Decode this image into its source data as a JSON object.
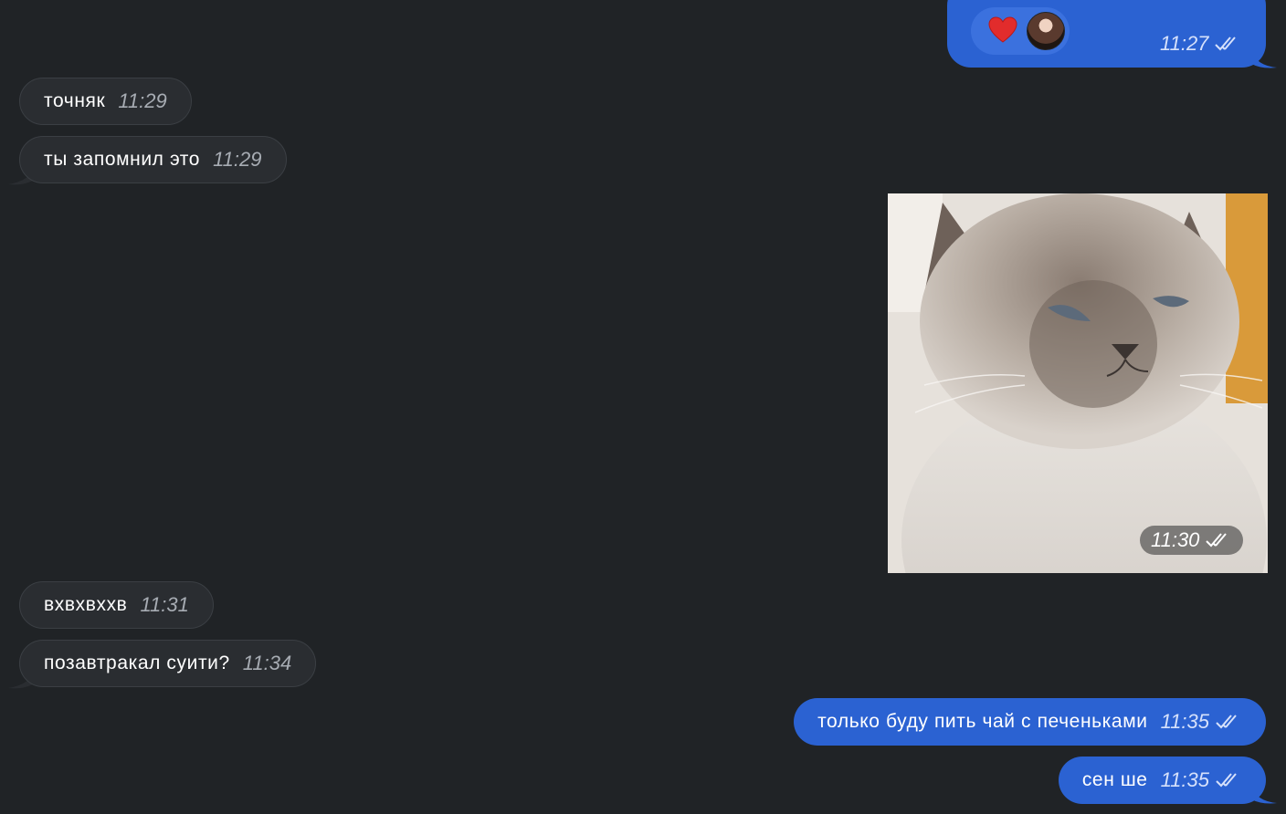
{
  "messages": {
    "top_out": {
      "time": "11:27",
      "reaction": "heart-icon"
    },
    "m1": {
      "text": "точняк",
      "time": "11:29"
    },
    "m2": {
      "text": "ты запомнил это",
      "time": "11:29"
    },
    "photo": {
      "time": "11:30"
    },
    "m3": {
      "text": "вхвхвххв",
      "time": "11:31"
    },
    "m4": {
      "text": "позавтракал суити?",
      "time": "11:34"
    },
    "m5": {
      "text": "только буду пить чай с печеньками",
      "time": "11:35"
    },
    "m6": {
      "text": "сен ше",
      "time": "11:35"
    }
  },
  "colors": {
    "background": "#202326",
    "incoming_bubble": "#2a2d31",
    "outgoing_bubble": "#2b62d2"
  }
}
